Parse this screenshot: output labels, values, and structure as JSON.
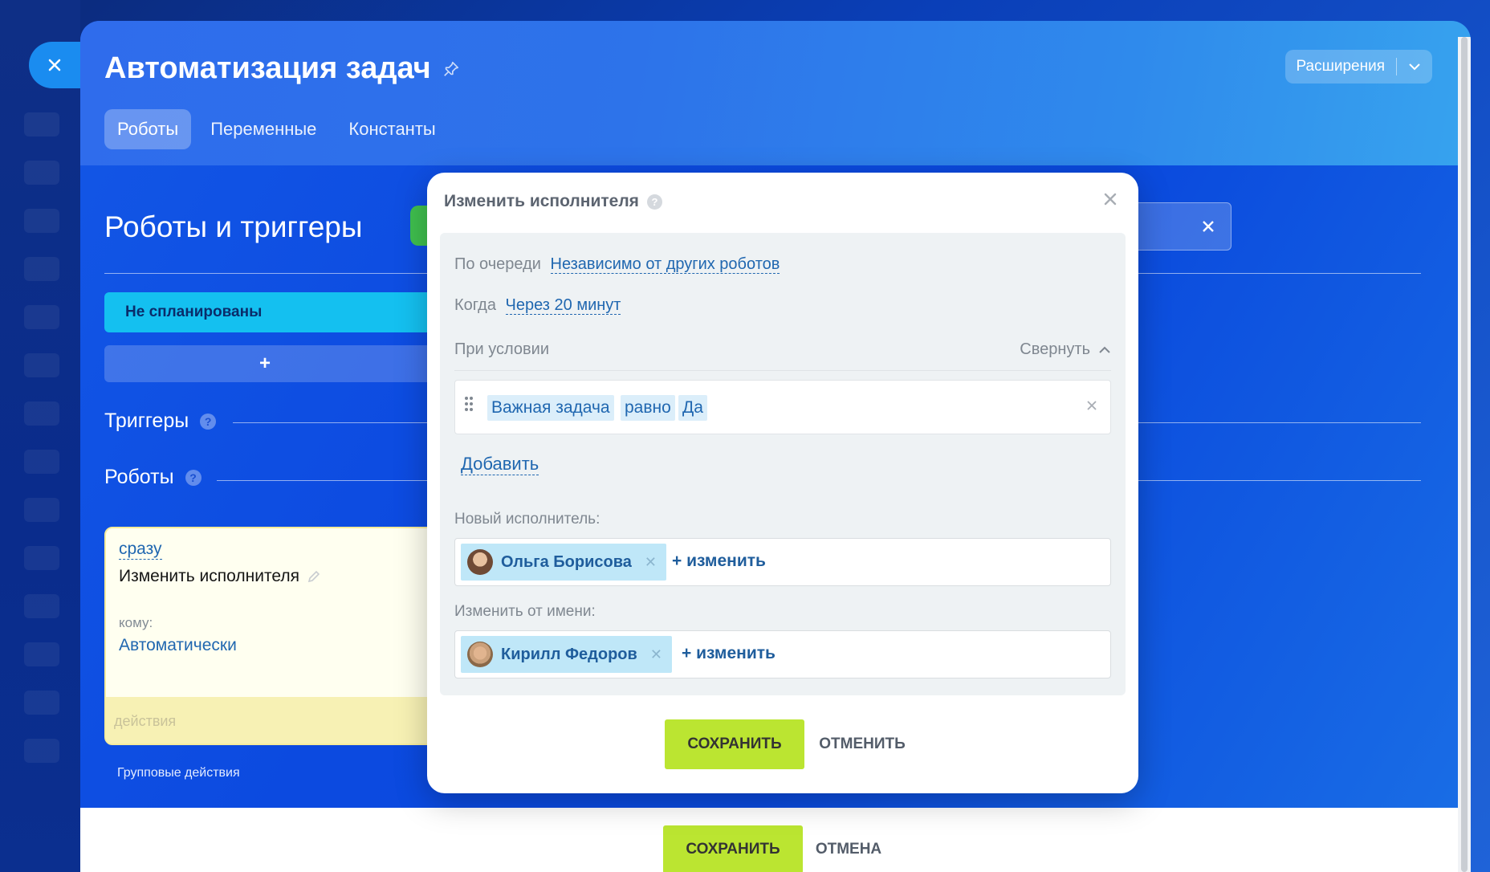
{
  "window": {
    "title": "Автоматизация задач"
  },
  "header": {
    "extensions_label": "Расширения",
    "tabs": [
      {
        "label": "Роботы",
        "active": true
      },
      {
        "label": "Переменные",
        "active": false
      },
      {
        "label": "Константы",
        "active": false
      }
    ]
  },
  "main": {
    "section_title": "Роботы и триггеры",
    "status_column": "Не спланированы",
    "add_symbol": "+",
    "triggers_label": "Триггеры",
    "robots_label": "Роботы",
    "robot_card": {
      "when": "сразу",
      "name": "Изменить исполнителя",
      "to_label": "кому:",
      "to_value": "Автоматически",
      "footer": "действия"
    },
    "group_actions": "Групповые действия"
  },
  "bottom_bar": {
    "save": "СОХРАНИТЬ",
    "cancel": "ОТМЕНА"
  },
  "popup": {
    "title": "Изменить исполнителя",
    "queue_label": "По очереди",
    "queue_value": "Независимо от других роботов",
    "when_label": "Когда",
    "when_value": "Через 20 минут",
    "condition_label": "При условии",
    "collapse_label": "Свернуть",
    "condition": {
      "field": "Важная задача",
      "operator": "равно",
      "value": "Да"
    },
    "add_label": "Добавить",
    "new_assignee_label": "Новый исполнитель:",
    "new_assignee": "Ольга Борисова",
    "change_label": "+ изменить",
    "on_behalf_label": "Изменить от имени:",
    "on_behalf": "Кирилл Федоров",
    "save": "СОХРАНИТЬ",
    "cancel": "ОТМЕНИТЬ"
  },
  "colors": {
    "accent_green": "#bbe531",
    "link_blue": "#2067b0",
    "status_cyan": "#14c0f0"
  }
}
